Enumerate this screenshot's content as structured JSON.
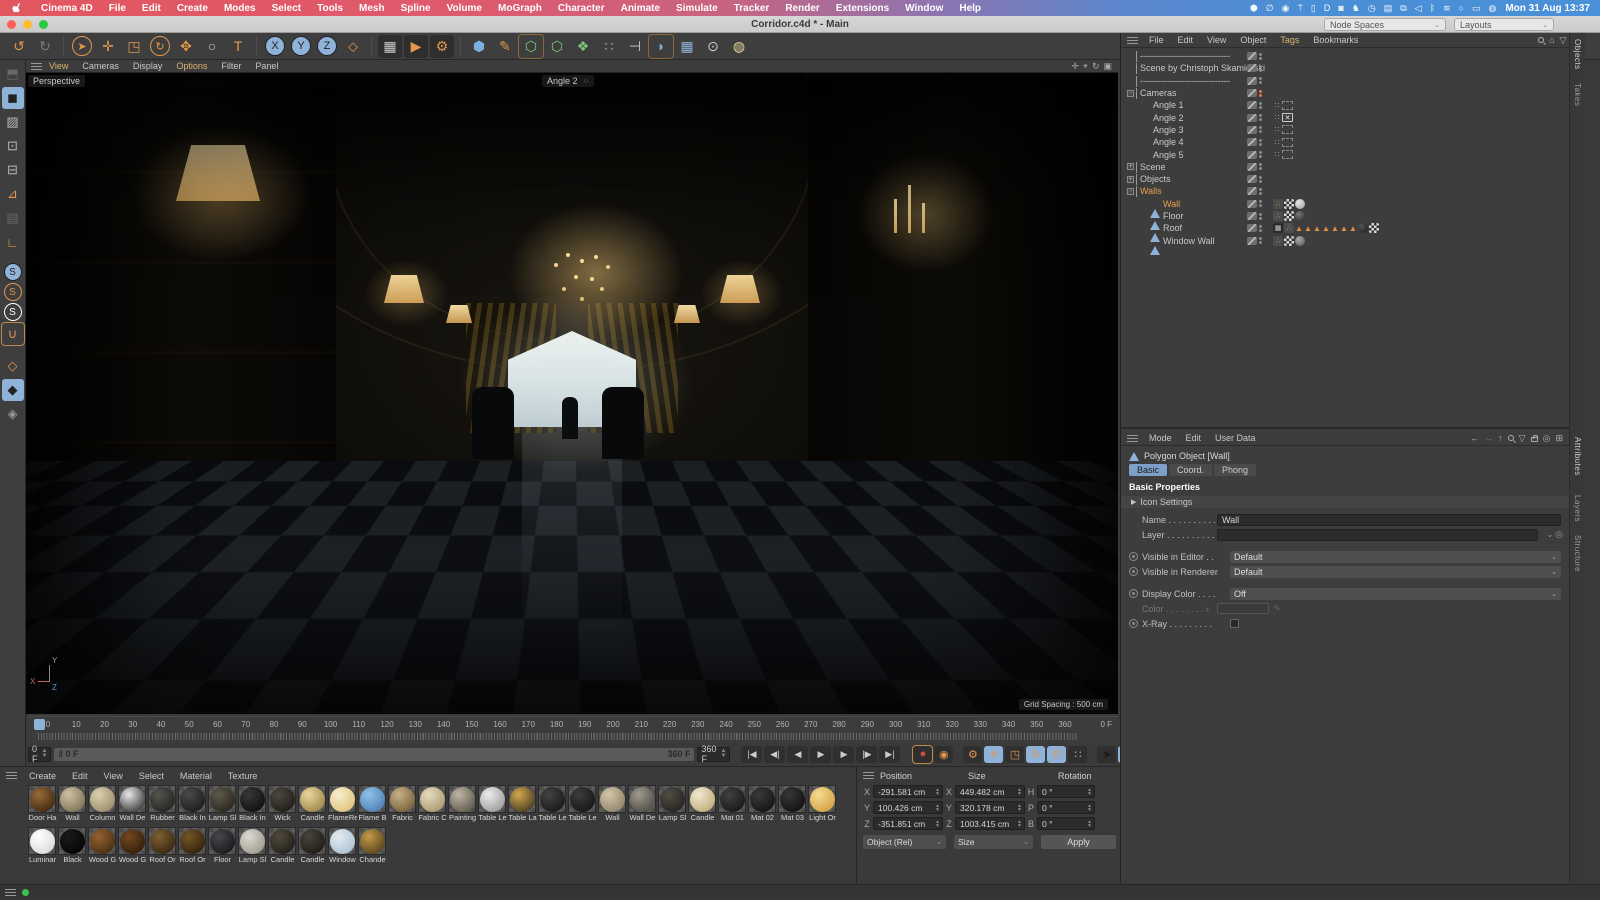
{
  "menubar": {
    "items": [
      "Cinema 4D",
      "File",
      "Edit",
      "Create",
      "Modes",
      "Select",
      "Tools",
      "Mesh",
      "Spline",
      "Volume",
      "MoGraph",
      "Character",
      "Animate",
      "Simulate",
      "Tracker",
      "Render",
      "Extensions",
      "Window",
      "Help"
    ],
    "status_icons": [
      {
        "name": "dropbox-icon",
        "glyph": "⬢"
      },
      {
        "name": "zero-app-icon",
        "glyph": "∅"
      },
      {
        "name": "red-dot-app-icon",
        "glyph": "◉"
      },
      {
        "name": "pin-app-icon",
        "glyph": "⍑"
      },
      {
        "name": "watch-icon",
        "glyph": "▯"
      },
      {
        "name": "d-app-icon",
        "glyph": "D"
      },
      {
        "name": "shield-check-icon",
        "glyph": "◙"
      },
      {
        "name": "swan-app-icon",
        "glyph": "♞"
      },
      {
        "name": "clock-icon",
        "glyph": "◷"
      },
      {
        "name": "flag-icon",
        "glyph": "▤"
      },
      {
        "name": "copy-icon",
        "glyph": "⧉"
      },
      {
        "name": "volume-icon",
        "glyph": "◁"
      },
      {
        "name": "bluetooth-icon",
        "glyph": "ᛒ"
      },
      {
        "name": "wifi-icon",
        "glyph": "≋"
      },
      {
        "name": "spotlight-icon",
        "glyph": "○"
      },
      {
        "name": "switch-icon",
        "glyph": "▭"
      },
      {
        "name": "siri-icon",
        "glyph": "◍"
      }
    ],
    "clock": "Mon 31 Aug 13:37"
  },
  "titlebar": {
    "title": "Corridor.c4d * - Main",
    "node_spaces": "Node Spaces",
    "layouts": "Layouts"
  },
  "toolbar": {
    "buttons": [
      {
        "name": "undo-icon",
        "glyph": "↺",
        "color": "#e0974a"
      },
      {
        "name": "redo-icon",
        "glyph": "↻",
        "color": "#7a7a7a"
      },
      {
        "sep": true
      },
      {
        "name": "live-selection-icon",
        "glyph": "➤",
        "color": "#e0974a",
        "circle": true
      },
      {
        "name": "move-icon",
        "glyph": "✛",
        "color": "#e0974a"
      },
      {
        "name": "scale-icon",
        "glyph": "◳",
        "color": "#e0974a"
      },
      {
        "name": "rotate-icon",
        "glyph": "↻",
        "color": "#e0974a",
        "circle": true
      },
      {
        "name": "psr-icon",
        "glyph": "✥",
        "color": "#e0974a"
      },
      {
        "name": "ring-icon",
        "glyph": "○",
        "color": "#cccccc"
      },
      {
        "name": "text-tool-icon",
        "glyph": "T",
        "color": "#e0974a"
      },
      {
        "sep": true
      },
      {
        "name": "x-axis-lock",
        "glyph": "X",
        "selected": true,
        "circle": true
      },
      {
        "name": "y-axis-lock",
        "glyph": "Y",
        "selected": true,
        "circle": true
      },
      {
        "name": "z-axis-lock",
        "glyph": "Z",
        "selected": true,
        "circle": true
      },
      {
        "name": "coordinate-system-icon",
        "glyph": "⬦",
        "color": "#e0974a"
      },
      {
        "sep": true
      },
      {
        "name": "render-view-icon",
        "glyph": "▦",
        "color": "#cccccc",
        "dark": true
      },
      {
        "name": "render-to-picture-icon",
        "glyph": "▶",
        "color": "#e0974a",
        "dark": true
      },
      {
        "name": "render-settings-icon",
        "glyph": "⚙",
        "color": "#e0974a",
        "dark": true
      },
      {
        "sep": true
      },
      {
        "name": "primitive-cube-icon",
        "glyph": "⬢",
        "color": "#7ab0e0"
      },
      {
        "name": "spline-pen-icon",
        "glyph": "✎",
        "color": "#e0974a"
      },
      {
        "name": "subdivision-surface-icon",
        "glyph": "⬡",
        "color": "#7ac87a",
        "boxed": true
      },
      {
        "name": "generator-icon",
        "glyph": "⬡",
        "color": "#7ac87a"
      },
      {
        "name": "deformer-icon",
        "glyph": "❖",
        "color": "#7ac87a"
      },
      {
        "name": "volume-builder-icon",
        "glyph": "∷",
        "color": "#7ac87a"
      },
      {
        "name": "constraint-icon",
        "glyph": "⊣",
        "color": "#cccccc"
      },
      {
        "name": "field-icon",
        "glyph": "◗",
        "color": "#7ab0e0",
        "boxed": true
      },
      {
        "name": "array-icon",
        "glyph": "▦",
        "color": "#8fb2d9"
      },
      {
        "name": "camera-icon",
        "glyph": "⊙",
        "color": "#cccccc"
      },
      {
        "name": "light-icon",
        "glyph": "◍",
        "color": "#e8d49a"
      }
    ]
  },
  "palette": {
    "buttons": [
      {
        "name": "make-editable-icon",
        "glyph": "⬒",
        "dim": true
      },
      {
        "name": "model-mode-icon",
        "glyph": "◼",
        "selblue": true
      },
      {
        "name": "texture-mode-icon",
        "glyph": "▨"
      },
      {
        "name": "points-mode-icon",
        "glyph": "⊡"
      },
      {
        "name": "edges-mode-icon",
        "glyph": "⊟"
      },
      {
        "name": "polygons-mode-icon",
        "glyph": "⊿",
        "color": "#e0974a"
      },
      {
        "name": "uv-mode-icon",
        "glyph": "▤",
        "dim": true
      },
      {
        "name": "enable-axis-icon",
        "glyph": "∟",
        "color": "#e0974a"
      },
      {
        "gap": true
      },
      {
        "name": "snap-enable-icon",
        "glyph": "S",
        "selblue": true,
        "circle": true
      },
      {
        "name": "snap-modes-icon",
        "glyph": "S",
        "color": "#e0974a",
        "circle": true
      },
      {
        "name": "snap-settings-icon",
        "glyph": "S",
        "color": "#ffffff",
        "circle": true
      },
      {
        "name": "magnet-icon",
        "glyph": "∪",
        "color": "#e0974a",
        "selorange": true
      },
      {
        "gap": true
      },
      {
        "name": "workplane-icon",
        "glyph": "◇",
        "color": "#e0974a"
      },
      {
        "name": "workplane-lock-icon",
        "glyph": "◆",
        "selblue": true
      },
      {
        "name": "workplane-reset-icon",
        "glyph": "◈",
        "color": "#999999"
      }
    ]
  },
  "viewport": {
    "menu": [
      "View",
      "Cameras",
      "Display",
      "Options",
      "Filter",
      "Panel"
    ],
    "hot_items": [
      "View",
      "Options"
    ],
    "nav_icons": [
      {
        "name": "pan-view-icon",
        "glyph": "✛"
      },
      {
        "name": "dolly-view-icon",
        "glyph": "⌖"
      },
      {
        "name": "rotate-view-icon",
        "glyph": "↻"
      },
      {
        "name": "toggle-view-icon",
        "glyph": "▣"
      }
    ],
    "view_label": "Perspective",
    "camera_label": "Angle 2",
    "grid_spacing": "Grid Spacing : 500 cm",
    "axis_x": "X",
    "axis_y": "Y",
    "axis_z": "Z"
  },
  "object_manager": {
    "menu": [
      "File",
      "Edit",
      "View",
      "Object",
      "Tags",
      "Bookmarks"
    ],
    "hot_items": [
      "Tags"
    ],
    "tree": [
      {
        "name": "------------------------------",
        "icon": "null",
        "depth": 0
      },
      {
        "name": "Scene by Christoph Skamierski",
        "icon": "null",
        "depth": 0
      },
      {
        "name": "------------------------------",
        "icon": "null",
        "depth": 0
      },
      {
        "name": "Cameras",
        "icon": "null",
        "depth": 0,
        "expand": "-",
        "dots": "orange"
      },
      {
        "name": "Angle 1",
        "icon": "camera",
        "depth": 1,
        "tags": [
          "camdots",
          "frame"
        ]
      },
      {
        "name": "Angle 2",
        "icon": "camera",
        "depth": 1,
        "tags": [
          "camdots",
          "frame-active"
        ]
      },
      {
        "name": "Angle 3",
        "icon": "camera",
        "depth": 1,
        "tags": [
          "camdots",
          "frame"
        ]
      },
      {
        "name": "Angle 4",
        "icon": "camera",
        "depth": 1,
        "tags": [
          "camdots",
          "frame"
        ]
      },
      {
        "name": "Angle 5",
        "icon": "camera",
        "depth": 1,
        "tags": [
          "camdots",
          "frame"
        ]
      },
      {
        "name": "Scene",
        "icon": "null",
        "depth": 0,
        "expand": "+"
      },
      {
        "name": "Objects",
        "icon": "null",
        "depth": 0,
        "expand": "+"
      },
      {
        "name": "Walls",
        "icon": "null",
        "depth": 0,
        "expand": "-",
        "selected": true
      },
      {
        "name": "Wall",
        "icon": "poly",
        "depth": 1,
        "selected": true,
        "tags": [
          "phong",
          "uv",
          "mat:#e8e8e8:#9a9a9a"
        ]
      },
      {
        "name": "Floor",
        "icon": "poly",
        "depth": 1,
        "tags": [
          "phong",
          "uv",
          "mat:#777777:#2a2a2a"
        ]
      },
      {
        "name": "Roof",
        "icon": "poly",
        "depth": 1,
        "tags": [
          "comp",
          "phong",
          "tri",
          "tri",
          "tri",
          "tri",
          "tri",
          "tri",
          "tri",
          "mat:#555555:#1a1a1a",
          "uv"
        ]
      },
      {
        "name": "Window Wall",
        "icon": "poly",
        "depth": 1,
        "tags": [
          "phong",
          "uv",
          "mat:#aaaaaa:#555555"
        ]
      }
    ]
  },
  "attributes": {
    "menu": [
      "Mode",
      "Edit",
      "User Data"
    ],
    "object_title": "Polygon Object [Wall]",
    "tabs": [
      {
        "label": "Basic",
        "selected": true
      },
      {
        "label": "Coord.",
        "selected": false
      },
      {
        "label": "Phong",
        "selected": false
      }
    ],
    "section": "Basic Properties",
    "icon_settings": "Icon Settings",
    "fields": [
      {
        "type": "text",
        "name": "name",
        "label": "Name . . . . . . . . . .",
        "value": "Wall"
      },
      {
        "type": "layer",
        "name": "layer",
        "label": "Layer . . . . . . . . . ."
      },
      {
        "type": "gap"
      },
      {
        "type": "dropdown",
        "name": "visible-in-editor",
        "label": "Visible in Editor . .",
        "value": "Default",
        "key": true
      },
      {
        "type": "dropdown",
        "name": "visible-in-renderer",
        "label": "Visible in Renderer",
        "value": "Default",
        "key": true
      },
      {
        "type": "gap"
      },
      {
        "type": "dropdown",
        "name": "display-color",
        "label": "Display Color . . . .",
        "value": "Off",
        "key": true
      },
      {
        "type": "color",
        "name": "color",
        "label": "Color . . . . . . . . ›"
      },
      {
        "type": "checkbox",
        "name": "x-ray",
        "label": "X-Ray . . . . . . . . .",
        "key": true
      }
    ]
  },
  "side_tabs": {
    "top": [
      "Objects",
      "Takes"
    ],
    "bottom": [
      "Attributes",
      "Layers",
      "Structure"
    ]
  },
  "timeline": {
    "start": 0,
    "end": 360,
    "step": 10,
    "end_label": "0 F"
  },
  "transport": {
    "current": "0 F",
    "slider_left": "0 F",
    "slider_right": "360 F",
    "range_end": "360 F",
    "buttons": [
      {
        "name": "goto-start-button",
        "glyph": "|◀"
      },
      {
        "name": "previous-key-button",
        "glyph": "◀|"
      },
      {
        "name": "previous-frame-button",
        "glyph": "◀"
      },
      {
        "name": "play-button",
        "glyph": "▶"
      },
      {
        "name": "next-frame-button",
        "glyph": "▶"
      },
      {
        "name": "next-key-button",
        "glyph": "|▶"
      },
      {
        "name": "goto-end-button",
        "glyph": "▶|"
      }
    ],
    "record_buttons": [
      {
        "name": "record-keyframe-button",
        "glyph": "●",
        "color": "#d05040",
        "selbox": true
      },
      {
        "name": "autokey-button",
        "glyph": "◉",
        "color": "#e0974a"
      },
      {
        "gap": true
      },
      {
        "name": "keyframe-settings-button",
        "glyph": "⚙",
        "color": "#e0974a"
      },
      {
        "name": "record-position-button",
        "glyph": "✛",
        "blue": true
      },
      {
        "name": "record-scale-button",
        "glyph": "◳",
        "color": "#e0974a"
      },
      {
        "name": "record-rotation-button",
        "glyph": "↻",
        "blue": true
      },
      {
        "name": "record-parameter-button",
        "glyph": "Ⓟ",
        "blue": true
      },
      {
        "name": "record-pla-button",
        "glyph": "∷",
        "color": "#aaaaaa"
      },
      {
        "gap": true
      },
      {
        "name": "keyframe-selection-button",
        "glyph": "➤",
        "color": "#1a1a1a"
      },
      {
        "name": "render-preview-button",
        "glyph": "▥",
        "blue": true
      }
    ]
  },
  "materials": {
    "menu": [
      "Create",
      "Edit",
      "View",
      "Select",
      "Material",
      "Texture"
    ],
    "row1": [
      {
        "name": "Door Ha",
        "c1": "#9a6a38",
        "c2": "#2c1a08"
      },
      {
        "name": "Wall",
        "c1": "#cfc2a2",
        "c2": "#6e6248"
      },
      {
        "name": "Column",
        "c1": "#ddd0ae",
        "c2": "#8c7e5e"
      },
      {
        "name": "Wall De",
        "c1": "#e8e8e8",
        "c2": "#141414"
      },
      {
        "name": "Rubber",
        "c1": "#55534e",
        "c2": "#1b1a17"
      },
      {
        "name": "Black In",
        "c1": "#4a4a4a",
        "c2": "#121212"
      },
      {
        "name": "Lamp Sl",
        "c1": "#5e584c",
        "c2": "#201c14"
      },
      {
        "name": "Black In",
        "c1": "#383838",
        "c2": "#060606"
      },
      {
        "name": "Wick",
        "c1": "#4c4840",
        "c2": "#16130e"
      },
      {
        "name": "Candle",
        "c1": "#ead8a0",
        "c2": "#8c7234"
      },
      {
        "name": "FlameRe",
        "c1": "#f6eecf",
        "c2": "#dcb868"
      },
      {
        "name": "Flame B",
        "c1": "#8ec0ea",
        "c2": "#4272a8"
      },
      {
        "name": "Fabric",
        "c1": "#c8b084",
        "c2": "#64502a"
      },
      {
        "name": "Fabric C",
        "c1": "#e8dcbc",
        "c2": "#9a8a60"
      },
      {
        "name": "Painting",
        "c1": "#bcb4a4",
        "c2": "#504a3e"
      },
      {
        "name": "Table Le",
        "c1": "#ececec",
        "c2": "#8a8a8a"
      },
      {
        "name": "Table La",
        "c1": "#d0a850",
        "c2": "#2c2416"
      },
      {
        "name": "Table Le",
        "c1": "#424242",
        "c2": "#101010"
      },
      {
        "name": "Table Le",
        "c1": "#3c3c3c",
        "c2": "#0e0e0e"
      },
      {
        "name": "Wall",
        "c1": "#d2c6a8",
        "c2": "#80765c"
      },
      {
        "name": "Wall De",
        "c1": "#a09a90",
        "c2": "#403c34"
      },
      {
        "name": "Lamp Sl",
        "c1": "#524e46",
        "c2": "#1c1914"
      },
      {
        "name": "Candle",
        "c1": "#f0e8d0",
        "c2": "#b4a068"
      },
      {
        "name": "Mat 01",
        "c1": "#404040",
        "c2": "#101010"
      },
      {
        "name": "Mat 02",
        "c1": "#3a3a3a",
        "c2": "#0c0c0c"
      },
      {
        "name": "Mat 03",
        "c1": "#363636",
        "c2": "#0a0a0a"
      },
      {
        "name": "Light Or",
        "c1": "#f6dc92",
        "c2": "#ca9432"
      }
    ],
    "row2": [
      {
        "name": "Luminar",
        "c1": "#ffffff",
        "c2": "#d2d2d2"
      },
      {
        "name": "Black",
        "c1": "#1a1a1a",
        "c2": "#000000"
      },
      {
        "name": "Wood G",
        "c1": "#94622f",
        "c2": "#38220c"
      },
      {
        "name": "Wood G",
        "c1": "#714721",
        "c2": "#271505"
      },
      {
        "name": "Roof Or",
        "c1": "#806034",
        "c2": "#261908"
      },
      {
        "name": "Roof Or",
        "c1": "#745628",
        "c2": "#211504"
      },
      {
        "name": "Floor",
        "c1": "#46464c",
        "c2": "#0f0f12"
      },
      {
        "name": "Lamp Sl",
        "c1": "#dcd8d0",
        "c2": "#948e82"
      },
      {
        "name": "Candle",
        "c1": "#504a3c",
        "c2": "#181510"
      },
      {
        "name": "Candle",
        "c1": "#48433a",
        "c2": "#151210"
      },
      {
        "name": "Window",
        "c1": "#e4ecf2",
        "c2": "#a0b8ca"
      },
      {
        "name": "Chande",
        "c1": "#c09a46",
        "c2": "#422f12"
      }
    ]
  },
  "coordinates": {
    "position_label": "Position",
    "size_label": "Size",
    "rotation_label": "Rotation",
    "position": [
      {
        "axis": "X",
        "value": "-291.581 cm"
      },
      {
        "axis": "Y",
        "value": "100.426 cm"
      },
      {
        "axis": "Z",
        "value": "-351.851 cm"
      }
    ],
    "size": [
      {
        "axis": "X",
        "value": "449.482 cm"
      },
      {
        "axis": "Y",
        "value": "320.178 cm"
      },
      {
        "axis": "Z",
        "value": "1003.415 cm"
      }
    ],
    "rotation": [
      {
        "axis": "H",
        "value": "0 °"
      },
      {
        "axis": "P",
        "value": "0 °"
      },
      {
        "axis": "B",
        "value": "0 °"
      }
    ],
    "mode_dropdown": "Object (Rel)",
    "size_dropdown": "Size",
    "apply": "Apply"
  }
}
